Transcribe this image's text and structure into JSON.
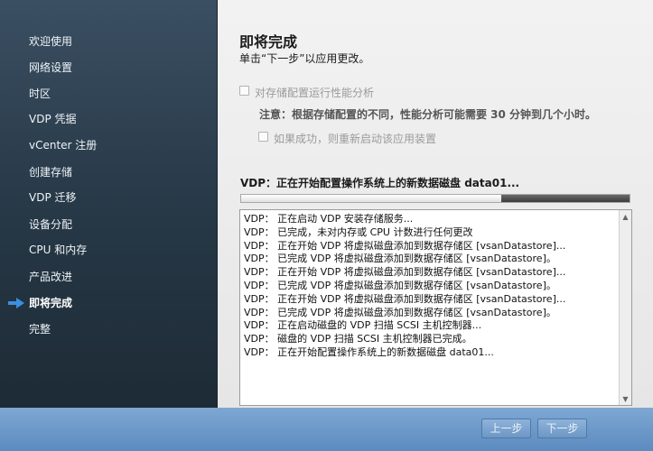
{
  "sidebar": {
    "items": [
      {
        "label": "欢迎使用"
      },
      {
        "label": "网络设置"
      },
      {
        "label": "时区"
      },
      {
        "label": "VDP 凭据"
      },
      {
        "label": "vCenter 注册"
      },
      {
        "label": "创建存储"
      },
      {
        "label": "VDP 迁移"
      },
      {
        "label": "设备分配"
      },
      {
        "label": "CPU 和内存"
      },
      {
        "label": "产品改进"
      },
      {
        "label": "即将完成"
      },
      {
        "label": "完整"
      }
    ],
    "active_index": 10
  },
  "main": {
    "title": "即将完成",
    "subtitle": "单击“下一步”以应用更改。",
    "perf_checkbox_label": "对存储配置运行性能分析",
    "perf_checked": false,
    "note": "注意：根据存储配置的不同，性能分析可能需要 30 分钟到几个小时。",
    "restart_checkbox_label": "如果成功，则重新启动该应用装置",
    "restart_checked": false,
    "progress_label": "VDP：正在开始配置操作系统上的新数据磁盘 data01...",
    "progress_fraction": 0.67,
    "log_lines": [
      "VDP： 正在启动 VDP 安装存储服务...",
      "VDP： 已完成，未对内存或 CPU 计数进行任何更改",
      "VDP： 正在开始 VDP 将虚拟磁盘添加到数据存储区 [vsanDatastore]...",
      "VDP： 已完成 VDP 将虚拟磁盘添加到数据存储区 [vsanDatastore]。",
      "VDP： 正在开始 VDP 将虚拟磁盘添加到数据存储区 [vsanDatastore]...",
      "VDP： 已完成 VDP 将虚拟磁盘添加到数据存储区 [vsanDatastore]。",
      "VDP： 正在开始 VDP 将虚拟磁盘添加到数据存储区 [vsanDatastore]...",
      "VDP： 已完成 VDP 将虚拟磁盘添加到数据存储区 [vsanDatastore]。",
      "VDP： 正在启动磁盘的 VDP 扫描 SCSI 主机控制器...",
      "VDP： 磁盘的 VDP 扫描 SCSI 主机控制器已完成。",
      "VDP： 正在开始配置操作系统上的新数据磁盘 data01..."
    ]
  },
  "footer": {
    "back_label": "上一步",
    "next_label": "下一步"
  },
  "icons": {
    "active_arrow": "right-arrow-icon",
    "scroll_up": "triangle-up-icon",
    "scroll_down": "triangle-down-icon"
  },
  "colors": {
    "active_arrow": "#3b8fe0",
    "sidebar_bg": "#263745",
    "frame_blue": "#6f9ac8"
  }
}
